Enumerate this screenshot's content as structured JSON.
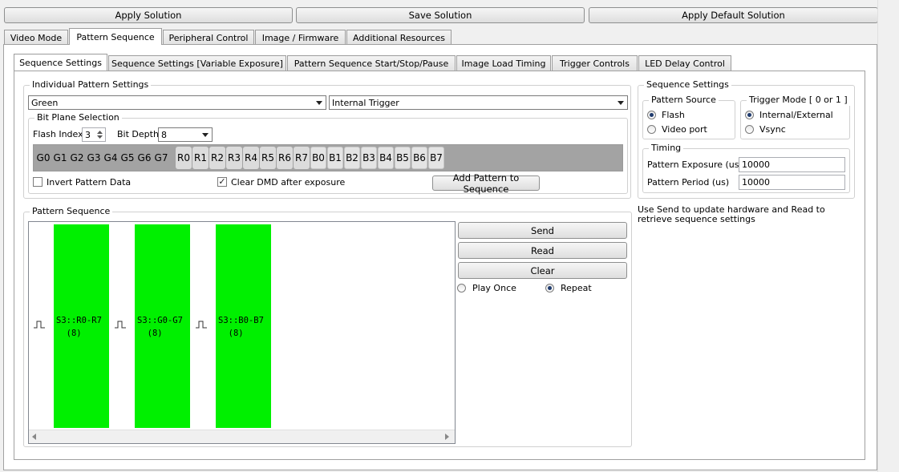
{
  "toolbar": {
    "apply_solution": "Apply Solution",
    "save_solution": "Save Solution",
    "apply_default_solution": "Apply Default Solution"
  },
  "main_tabs": [
    "Video Mode",
    "Pattern Sequence",
    "Peripheral Control",
    "Image / Firmware",
    "Additional Resources"
  ],
  "main_tab_active": "Pattern Sequence",
  "sub_tabs": [
    "Sequence Settings",
    "Sequence Settings [Variable Exposure]",
    "Pattern Sequence Start/Stop/Pause",
    "Image Load Timing",
    "Trigger Controls",
    "LED Delay Control"
  ],
  "sub_tab_active": "Sequence Settings",
  "individual": {
    "title": "Individual Pattern Settings",
    "color_select": "Green",
    "trigger_select": "Internal Trigger",
    "bitplane": {
      "title": "Bit Plane Selection",
      "flash_index_label": "Flash Index",
      "flash_index_value": "3",
      "bit_depth_label": "Bit Depth",
      "bit_depth_value": "8",
      "bits": [
        "G0",
        "G1",
        "G2",
        "G3",
        "G4",
        "G5",
        "G6",
        "G7",
        "R0",
        "R1",
        "R2",
        "R3",
        "R4",
        "R5",
        "R6",
        "R7",
        "B0",
        "B1",
        "B2",
        "B3",
        "B4",
        "B5",
        "B6",
        "B7"
      ]
    },
    "invert_label": "Invert Pattern Data",
    "invert_checked": false,
    "clear_dmd_label": "Clear DMD after exposure",
    "clear_dmd_checked": true,
    "add_button": "Add Pattern to Sequence"
  },
  "sequence_settings": {
    "title": "Sequence Settings",
    "pattern_source": {
      "title": "Pattern Source",
      "options": [
        "Flash",
        "Video port"
      ],
      "selected": "Flash"
    },
    "trigger_mode": {
      "title": "Trigger Mode [ 0 or 1 ]",
      "options": [
        "Internal/External",
        "Vsync"
      ],
      "selected": "Internal/External"
    },
    "timing": {
      "title": "Timing",
      "exposure_label": "Pattern Exposure (us)",
      "exposure_value": "10000",
      "period_label": "Pattern Period (us)",
      "period_value": "10000"
    }
  },
  "help_text": "Use Send to update hardware and Read to retrieve sequence settings",
  "pattern_sequence": {
    "title": "Pattern Sequence",
    "items": [
      {
        "line1": "S3::R0-R7",
        "line2": "(8)",
        "color": "#00f000"
      },
      {
        "line1": "S3::G0-G7",
        "line2": "(8)",
        "color": "#00f000"
      },
      {
        "line1": "S3::B0-B7",
        "line2": "(8)",
        "color": "#00f000"
      }
    ],
    "send_button": "Send",
    "read_button": "Read",
    "clear_button": "Clear",
    "play_once_label": "Play Once",
    "repeat_label": "Repeat",
    "play_mode": "Repeat"
  }
}
